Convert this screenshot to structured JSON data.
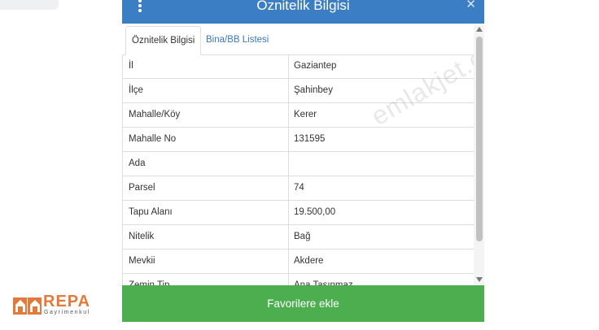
{
  "modal": {
    "title": "Öznitelik Bilgisi",
    "close_glyph": "✕",
    "tabs": [
      {
        "label": "Öznitelik Bilgisi",
        "active": true
      },
      {
        "label": "Bina/BB Listesi",
        "active": false
      }
    ],
    "rows": [
      {
        "label": "İl",
        "value": "Gaziantep"
      },
      {
        "label": "İlçe",
        "value": "Şahinbey"
      },
      {
        "label": "Mahalle/Köy",
        "value": "Kerer"
      },
      {
        "label": "Mahalle No",
        "value": "131595"
      },
      {
        "label": "Ada",
        "value": ""
      },
      {
        "label": "Parsel",
        "value": "74"
      },
      {
        "label": "Tapu Alanı",
        "value": "19.500,00"
      },
      {
        "label": "Nitelik",
        "value": "Bağ"
      },
      {
        "label": "Mevkii",
        "value": "Akdere"
      },
      {
        "label": "Zemin Tip",
        "value": "Ana Taşınmaz"
      }
    ],
    "favorite_button": "Favorilere ekle"
  },
  "watermark": "emlakjet.com",
  "logo": {
    "name": "REPA",
    "subtitle": "Gayrimenkul"
  },
  "colors": {
    "header": "#3c7ec4",
    "button": "#4cae4f",
    "link": "#3a78b8",
    "logo": "#e07b3c"
  }
}
